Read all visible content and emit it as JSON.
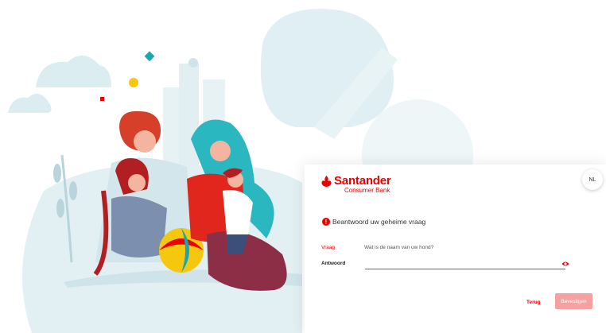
{
  "brand": {
    "name": "Santander",
    "subtitle": "Consumer Bank",
    "color": "#ec0000"
  },
  "language": {
    "label": "NL"
  },
  "form": {
    "heading": "Beantwoord uw geheime vraag",
    "question_label": "Vraag",
    "question_value": "Wat is de naam van uw hond?",
    "answer_label": "Antwoord",
    "answer_value": "",
    "info_icon": "info-icon",
    "visibility_icon": "eye-icon"
  },
  "actions": {
    "back_label": "Terug",
    "confirm_label": "Bevestigen"
  },
  "colors": {
    "primary": "#ec0000",
    "disabled_button": "#f6a0a0"
  }
}
